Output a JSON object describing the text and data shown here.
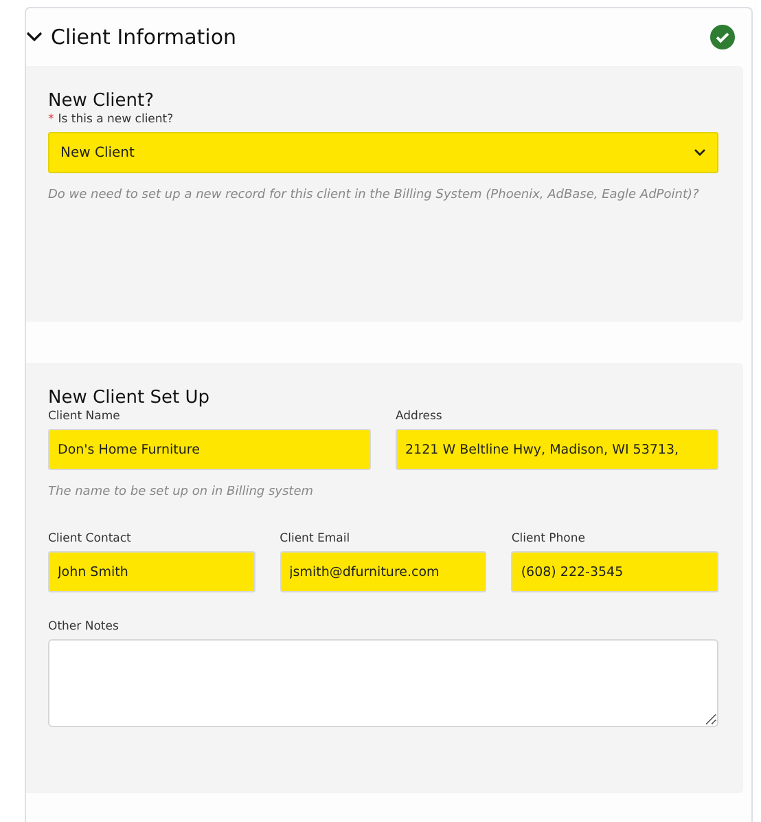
{
  "section": {
    "title": "Client Information",
    "expanded": true,
    "complete": true
  },
  "panels": [
    {
      "title": "New Client?",
      "rows": [
        [
          {
            "kind": "select",
            "required_mark": "*",
            "label": "Is this a new client?",
            "value": "New Client",
            "highlighted": true,
            "help": "Do we need to set up a new record for this client in the Billing System (Phoenix, AdBase, Eagle AdPoint)?"
          }
        ]
      ]
    },
    {
      "title": "New Client Set Up",
      "rows": [
        [
          {
            "kind": "text",
            "label": "Client Name",
            "value": "Don's Home Furniture",
            "highlighted": true,
            "help": "The name to be set up on in Billing system"
          },
          {
            "kind": "text",
            "label": "Address",
            "value": "2121 W Beltline Hwy, Madison, WI 53713,",
            "highlighted": true
          }
        ],
        [
          {
            "kind": "text",
            "label": "Client Contact",
            "value": "John Smith",
            "highlighted": true
          },
          {
            "kind": "text",
            "label": "Client Email",
            "value": "jsmith@dfurniture.com",
            "highlighted": true
          },
          {
            "kind": "text",
            "label": "Client Phone",
            "value": "(608) 222-3545",
            "highlighted": true
          }
        ],
        [
          {
            "kind": "textarea",
            "label": "Other Notes",
            "highlighted": false
          }
        ]
      ]
    }
  ]
}
